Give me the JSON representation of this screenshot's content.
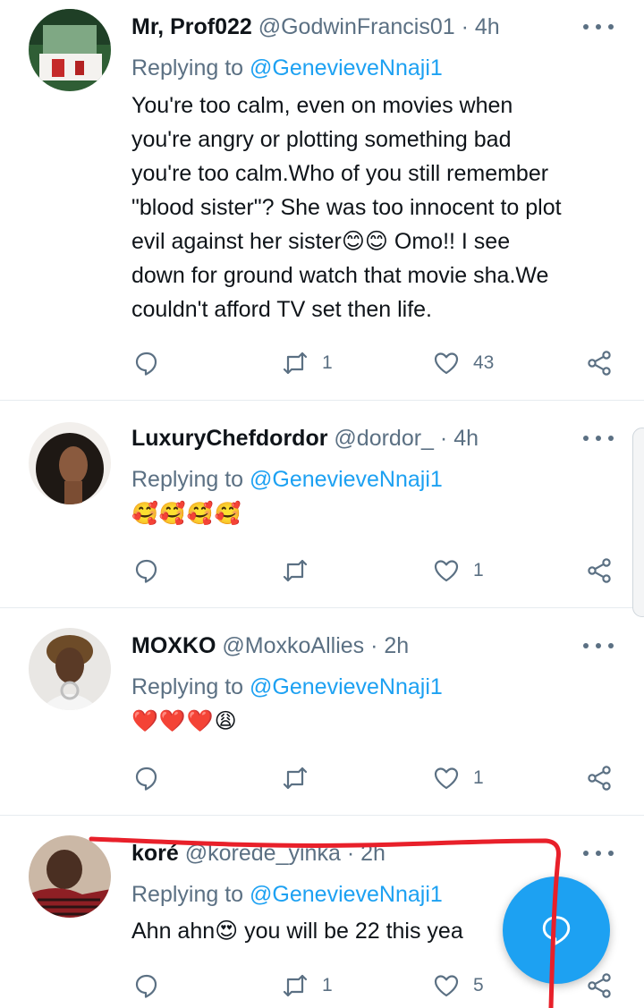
{
  "tweets": [
    {
      "name": "Mr, Prof022",
      "handle": "@GodwinFrancis01",
      "time": "4h",
      "replying_prefix": "Replying to ",
      "replying_to": "@GenevieveNnaji1",
      "lines": [
        "You're too calm, even on movies when",
        "you're angry or plotting something bad",
        "you're too calm.Who of you still remember",
        "\"blood sister\"? She was too innocent to plot",
        "evil against her sister😊😊 Omo!! I see",
        "down for ground watch that movie sha.We",
        "couldn't afford TV set then life."
      ],
      "retweets": "1",
      "likes": "43"
    },
    {
      "name": "LuxuryChefdordor",
      "handle": "@dordor_",
      "time": "4h",
      "replying_prefix": "Replying to ",
      "replying_to": "@GenevieveNnaji1",
      "lines": [
        "🥰🥰🥰🥰"
      ],
      "retweets": "",
      "likes": "1"
    },
    {
      "name": "MOXKO",
      "handle": "@MoxkoAllies",
      "time": "2h",
      "replying_prefix": "Replying to ",
      "replying_to": "@GenevieveNnaji1",
      "lines": [
        "❤️❤️❤️😩"
      ],
      "retweets": "",
      "likes": "1"
    },
    {
      "name": "koré",
      "handle": "@korede_yinka",
      "time": "2h",
      "replying_prefix": "Replying to ",
      "replying_to": "@GenevieveNnaji1",
      "lines": [
        "Ahn ahn😍 you will be 22 this yea"
      ],
      "retweets": "1",
      "likes": "5"
    }
  ],
  "dot_separator": "·",
  "colors": {
    "accent": "#1da1f2",
    "secondary_text": "#5b7083",
    "annotation": "#e8202a"
  },
  "icons": {
    "reply": "reply-icon",
    "retweet": "retweet-icon",
    "like": "heart-icon",
    "share": "share-icon",
    "compose": "compose-reply-icon",
    "more": "more-icon"
  }
}
